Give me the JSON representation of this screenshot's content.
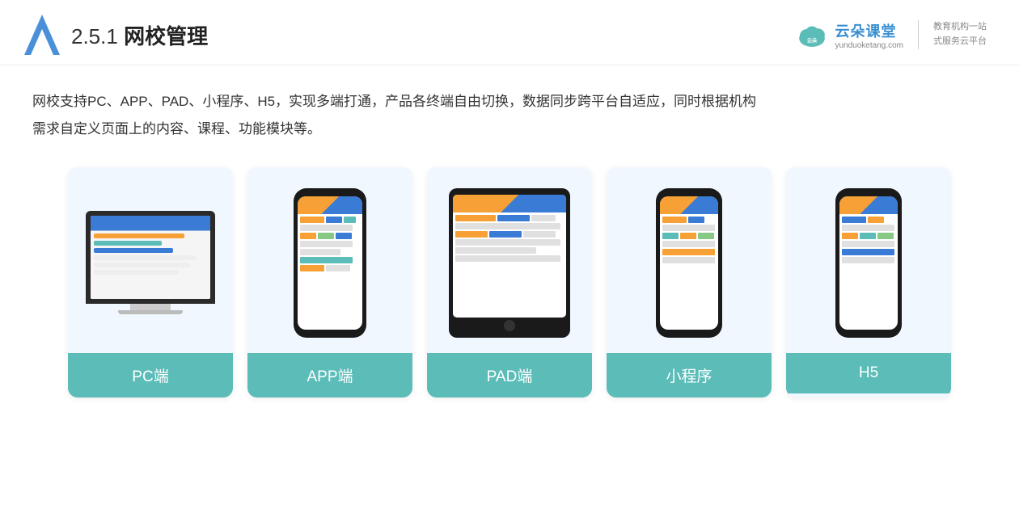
{
  "header": {
    "section_num": "2.5.1 ",
    "section_name": "网校管理",
    "logo_brand": "云朵课堂",
    "logo_url": "yunduoketang.com",
    "logo_divider": true,
    "logo_slogan_line1": "教育机构一站",
    "logo_slogan_line2": "式服务云平台"
  },
  "description": {
    "text_line1": "网校支持PC、APP、PAD、小程序、H5，实现多端打通，产品各终端自由切换，数据同步跨平台自适应，同时根据机构",
    "text_line2": "需求自定义页面上的内容、课程、功能模块等。"
  },
  "cards": [
    {
      "id": "pc",
      "label": "PC端",
      "type": "pc"
    },
    {
      "id": "app",
      "label": "APP端",
      "type": "phone"
    },
    {
      "id": "pad",
      "label": "PAD端",
      "type": "tablet"
    },
    {
      "id": "miniprogram",
      "label": "小程序",
      "type": "phone"
    },
    {
      "id": "h5",
      "label": "H5",
      "type": "phone"
    }
  ]
}
